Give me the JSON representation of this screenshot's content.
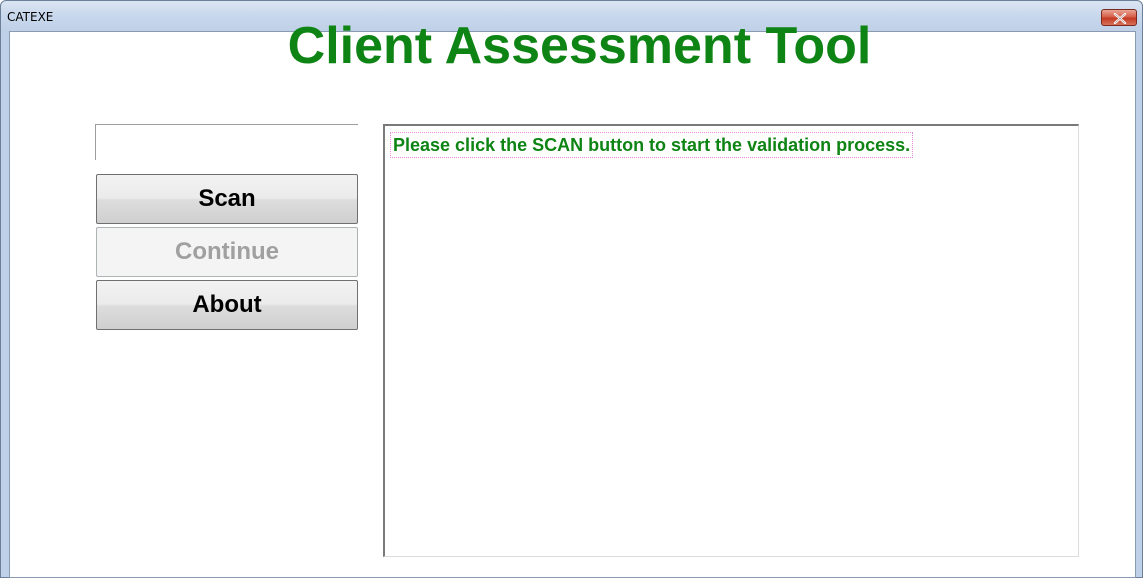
{
  "window": {
    "title": "CATEXE"
  },
  "app": {
    "title": "Client Assessment Tool"
  },
  "input": {
    "value": "",
    "placeholder": ""
  },
  "buttons": {
    "scan_label": "Scan",
    "continue_label": "Continue",
    "about_label": "About"
  },
  "log": {
    "message": "Please click the SCAN button to start the validation process."
  },
  "colors": {
    "title_green": "#0e8414",
    "message_green": "#0e8414",
    "close_button_red": "#c23b22"
  },
  "icons": {
    "close": "close-icon"
  }
}
